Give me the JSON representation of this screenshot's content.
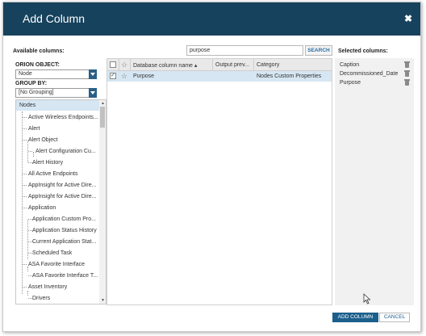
{
  "dialog": {
    "title": "Add Column",
    "close_icon": "close-icon"
  },
  "labels": {
    "available_columns": "Available columns:",
    "selected_columns": "Selected columns:",
    "orion_object": "ORION OBJECT:",
    "group_by": "GROUP BY:"
  },
  "search": {
    "value": "purpose",
    "button": "SEARCH"
  },
  "selects": {
    "orion_object": "Node",
    "group_by": "[No Grouping]"
  },
  "tree": {
    "root": "Nodes",
    "items": [
      "Active Wireless Endpoints...",
      "Alert",
      "Alert Object",
      "Alert Configuration Cu...",
      "Alert History",
      "All Active Endpoints",
      "AppInsight for Active Dire...",
      "AppInsight for Active Dire...",
      "Application",
      "Application Custom Pro...",
      "Application Status History",
      "Current Application Stat...",
      "Scheduled Task",
      "ASA Favorite Interface",
      "ASA Favorite Interface T...",
      "Asset Inventory",
      "Drivers"
    ]
  },
  "grid": {
    "headers": {
      "name": "Database column name ▴",
      "preview": "Output prev...",
      "category": "Category"
    },
    "rows": [
      {
        "name": "Purpose",
        "preview": "",
        "category": "Nodes Custom Properties",
        "checked": true
      }
    ]
  },
  "selected_columns": [
    "Caption",
    "Decommissioned_Date",
    "Purpose"
  ],
  "footer": {
    "add": "ADD COLUMN",
    "cancel": "CANCEL"
  },
  "colors": {
    "titlebar": "#16425d",
    "accent": "#1b5f8c",
    "selection": "#d6e6f2"
  }
}
